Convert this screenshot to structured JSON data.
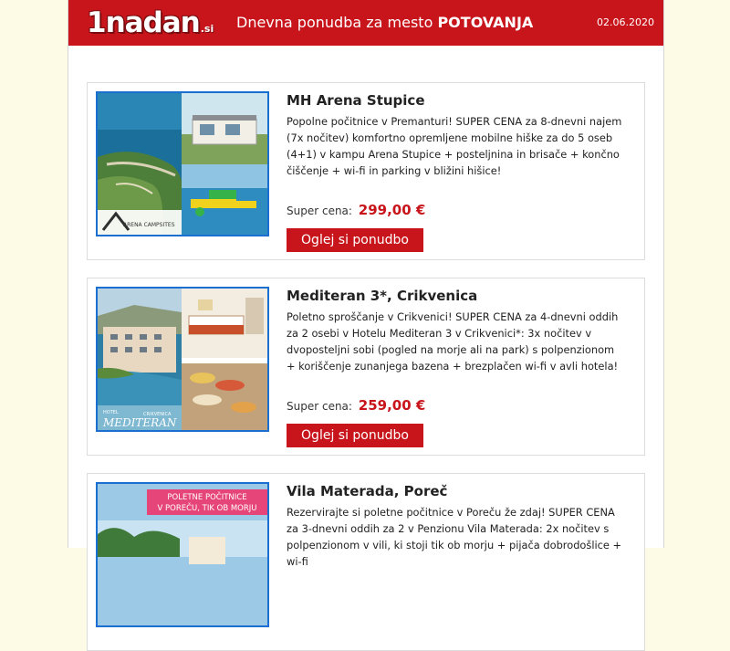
{
  "header": {
    "logo_main": "1nadan",
    "logo_tld": ".si",
    "headline_prefix": "Dnevna ponudba za mesto",
    "headline_city": "POTOVANJA",
    "date": "02.06.2020",
    "brand_color": "#c8151b"
  },
  "offers": [
    {
      "title": "MH Arena Stupice",
      "description": "Popolne počitnice v Premanturi! SUPER CENA za 8-dnevni najem (7x nočitev) komfortno opremljene mobilne hiške za do 5 oseb (4+1) v kampu Arena Stupice + posteljnina in brisače + končno čiščenje + wi-fi in parking v bližini hišice!",
      "price_label": "Super cena:",
      "price": "299,00 €",
      "button": "Oglej si ponudbo",
      "image_caption": "ARENA CAMPSITES"
    },
    {
      "title": "Mediteran 3*, Crikvenica",
      "description": "Poletno sproščanje v Crikvenici! SUPER CENA za 4-dnevni oddih za 2 osebi v Hotelu Mediteran 3 v Crikvenici*: 3x nočitev v dvoposteljni sobi (pogled na morje ali na park) s polpenzionom + koriščenje zunanjega bazena + brezplačen wi-fi v avli hotela!",
      "price_label": "Super cena:",
      "price": "259,00 €",
      "button": "Oglej si ponudbo",
      "image_caption_small": "HOTEL",
      "image_caption": "MEDITERAN",
      "image_caption_city": "CRIKVENICA"
    },
    {
      "title": "Vila Materada, Poreč",
      "description": "Rezervirajte si poletne počitnice v Poreču že zdaj! SUPER CENA za 3-dnevni oddih za 2 v Penzionu Vila Materada: 2x nočitev s polpenzionom v vili, ki stoji tik ob morju + pijača dobrodošlice + wi-fi",
      "image_banner_line1": "POLETNE POČITNICE",
      "image_banner_line2": "V POREČU, TIK OB MORJU"
    }
  ]
}
